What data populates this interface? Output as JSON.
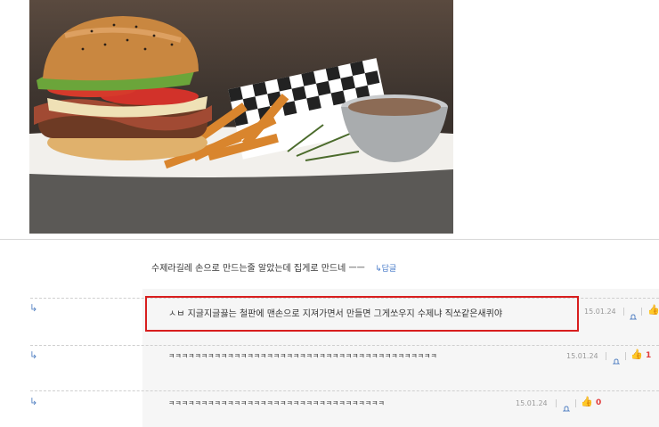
{
  "comment": {
    "text": "수제라길레 손으로 만드는줄 알았는데 집게로 만드네 ㅡㅡ",
    "reply_label": "↳답글"
  },
  "replies": [
    {
      "text": "ㅅㅂ 지글지글끓는 철판에 맨손으로 지져가면서 만들면 그게쏘우지 수제냐 직쏘같은새퀴야",
      "date": "15.01.24",
      "likes": ""
    },
    {
      "text": "ㅋㅋㅋㅋㅋㅋㅋㅋㅋㅋㅋㅋㅋㅋㅋㅋㅋㅋㅋㅋㅋㅋㅋㅋㅋㅋㅋㅋㅋㅋㅋㅋㅋㅋㅋㅋㅋㅋㅋㅋㅋ",
      "date": "15.01.24",
      "likes": "1"
    },
    {
      "text": "ㅋㅋㅋㅋㅋㅋㅋㅋㅋㅋㅋㅋㅋㅋㅋㅋㅋㅋㅋㅋㅋㅋㅋㅋㅋㅋㅋㅋㅋㅋㅋㅋㅋ",
      "date": "15.01.24",
      "likes": "0"
    }
  ],
  "icons": {
    "reply": "reply-arrow-icon",
    "alert": "bell-icon",
    "like": "thumbs-up-icon"
  },
  "colors": {
    "highlight": "#d81e1e",
    "link": "#4a7cc9",
    "likes": "#e23b3b"
  }
}
